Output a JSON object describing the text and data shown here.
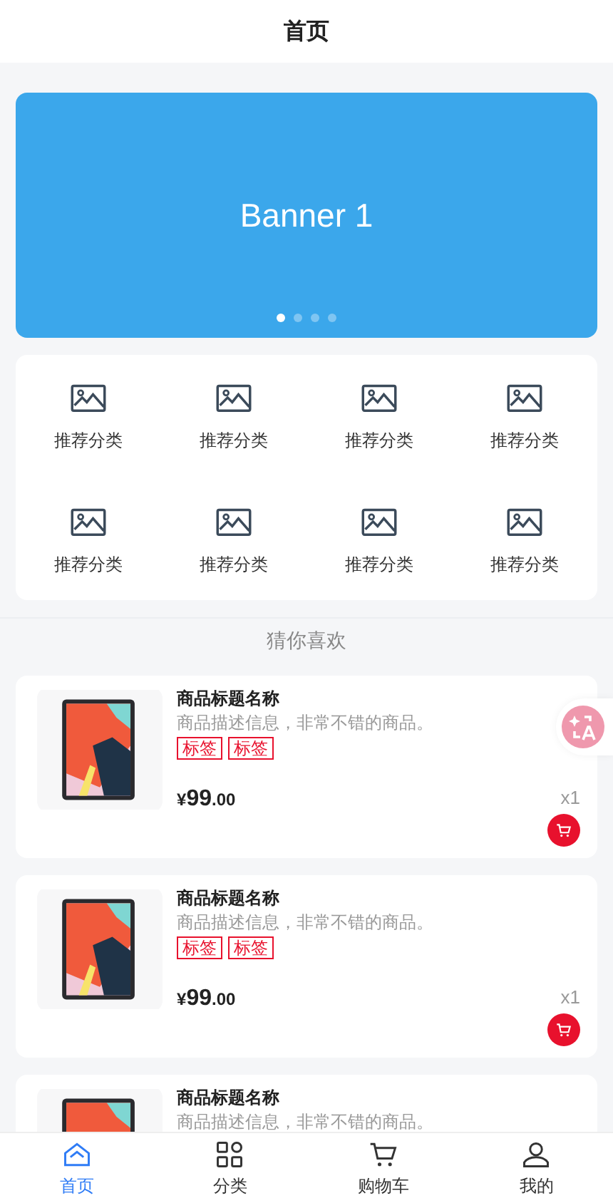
{
  "header": {
    "title": "首页"
  },
  "banner": {
    "title": "Banner 1",
    "dots": [
      {
        "selected": true
      },
      {
        "selected": false
      },
      {
        "selected": false
      },
      {
        "selected": false
      }
    ]
  },
  "categories": [
    {
      "label": "推荐分类"
    },
    {
      "label": "推荐分类"
    },
    {
      "label": "推荐分类"
    },
    {
      "label": "推荐分类"
    },
    {
      "label": "推荐分类"
    },
    {
      "label": "推荐分类"
    },
    {
      "label": "推荐分类"
    },
    {
      "label": "推荐分类"
    }
  ],
  "section_title": "猜你喜欢",
  "products": [
    {
      "title": "商品标题名称",
      "description": "商品描述信息，非常不错的商品。",
      "tags": [
        "标签",
        "标签"
      ],
      "currency": "¥",
      "price_integer": "99",
      "price_fraction": ".00",
      "quantity": "x1"
    },
    {
      "title": "商品标题名称",
      "description": "商品描述信息，非常不错的商品。",
      "tags": [
        "标签",
        "标签"
      ],
      "currency": "¥",
      "price_integer": "99",
      "price_fraction": ".00",
      "quantity": "x1"
    },
    {
      "title": "商品标题名称",
      "description": "商品描述信息，非常不错的商品。"
    }
  ],
  "tab_bar": [
    {
      "kind": "home",
      "label": "首页",
      "selected": true
    },
    {
      "kind": "grid",
      "label": "分类",
      "selected": false
    },
    {
      "kind": "cart",
      "label": "购物车",
      "selected": false
    },
    {
      "kind": "user",
      "label": "我的",
      "selected": false
    }
  ]
}
